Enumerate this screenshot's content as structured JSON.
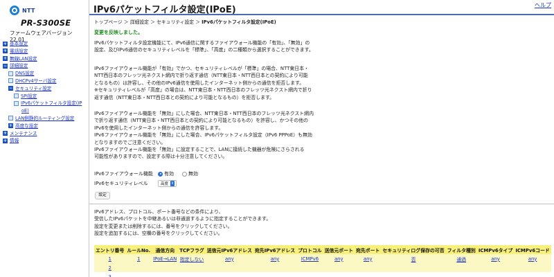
{
  "sidebar": {
    "logo_ntt": "NTT",
    "logo_model": "PR-S300SE",
    "firmware": "ファームウェアバージョン 22.01",
    "items": [
      {
        "label": "基本設定",
        "icon": "plus-box-icon",
        "level": 1
      },
      {
        "label": "電話設定",
        "icon": "plus-box-icon",
        "level": 1
      },
      {
        "label": "無線LAN設定",
        "icon": "plus-box-icon",
        "level": 1
      },
      {
        "label": "詳細設定",
        "icon": "minus-box-icon",
        "level": 1
      },
      {
        "label": "DNS設定",
        "icon": "leaf-icon",
        "level": 2
      },
      {
        "label": "DHCPv4サーバ設定",
        "icon": "leaf-icon",
        "level": 2
      },
      {
        "label": "セキュリティ設定",
        "icon": "minus-box-icon",
        "level": 2
      },
      {
        "label": "SPI設定",
        "icon": "leaf-icon",
        "level": 3
      },
      {
        "label": "IPv6パケットフィルタ設定(IP",
        "icon": "leaf-icon",
        "level": 3
      },
      {
        "label": "oE)",
        "icon": "",
        "level": 4
      },
      {
        "label": "LAN側静的ルーティング設定",
        "icon": "leaf-icon",
        "level": 2
      },
      {
        "label": "高度な設定",
        "icon": "plus-box-icon",
        "level": 2
      },
      {
        "label": "メンテナンス",
        "icon": "plus-box-icon",
        "level": 1
      },
      {
        "label": "情報",
        "icon": "plus-box-icon",
        "level": 1
      }
    ]
  },
  "header": {
    "title": "IPv6パケットフィルタ設定(IPoE)",
    "help": "ヘルプ"
  },
  "breadcrumb": {
    "path": "トップページ ＞ 詳細設定 ＞ セキュリティ設定 ＞ ",
    "current": "IPv6パケットフィルタ設定(IPoE)"
  },
  "status": "変更を反映しました。",
  "description": {
    "p1": [
      "IPv6パケットフィルタ設定機能にて、IPv6通信に関するファイアウォール機能の「有効」、「無効」の",
      "設定、及びIPv6通信のセキュリティレベルを「標準」、「高度」の二種類から選択することができます。"
    ],
    "p2": [
      "IPv6ファイアウォール機能が「有効」でかつ、セキュリティレベルが「標準」の場合、NTT東日本・",
      "NTT西日本のフレッツ光ネクスト網内で折り返す通信（NTT東日本・NTT西日本との契約により可能",
      "となるもの）は許容し、その他のIPv6通信を使用したインターネット側からの通信を拒否します。",
      "※セキュリティレベルが「高度」の場合は、NTT東日本・NTT西日本のフレッツ光ネクスト網内で折り",
      "返す通信（NTT東日本・NTT西日本との契約により可能となるもの）を拒否します。"
    ],
    "p3": [
      "IPv6ファイアウォール機能を「無効」にした場合、NTT東日本・NTT西日本のフレッツ光ネクスト網内",
      "で折り返す通信（NTT東日本・NTT西日本との契約により可能となるもの）を許容し、かつその他の",
      "IPv6を使用したインターネット側からの通信を許容します。",
      "IPv6ファイアウォール機能を「無効」にした場合、IPv6パケットフィルタ設定（IPv6 PPPoE）も無効",
      "となりますのでご注意ください。",
      "IPv6ファイアウォール機能を「無効」に設定することで、LANに接続した機器が危険にさらされる",
      "可能性がありますので、設定する際は十分注意してください。"
    ],
    "p4": [
      "IPv6アドレス、プロトコル、ポート番号などの条件により、",
      "受信したIPv6パケットを中継あるいは非通過するように指定することができます。",
      "設定を変更または削除するには、番号をクリックしてください。",
      "設定を追加するには、空欄の番号をクリックしてください。"
    ]
  },
  "form": {
    "firewall_label": "IPv6ファイアウォール機能",
    "firewall_on": "有効",
    "firewall_off": "無効",
    "firewall_selected": "有効",
    "security_label": "IPv6セキュリティレベル",
    "security_value": "高度",
    "set_button": "設定"
  },
  "table": {
    "headers": [
      "エントリ番号",
      "ルールNo.",
      "通信方向",
      "TCPフラグ",
      "送信元IPv6アドレス",
      "宛先IPv6アドレス",
      "プロトコル",
      "送信元ポート",
      "宛先ポート",
      "セキュリティログ保存の可否",
      "フィルタ種別",
      "ICMPv6タイプ",
      "ICMPv6コード"
    ],
    "rows": [
      [
        "1",
        "1",
        "IPoE→LAN",
        "指定しない",
        "any",
        "any",
        "ICMPv6",
        "any",
        "any",
        "否",
        "通過",
        "any",
        "any"
      ],
      [
        "2",
        "",
        "",
        "",
        "",
        "",
        "",
        "",
        "",
        "",
        "",
        "",
        ""
      ],
      [
        "3",
        "",
        "",
        "",
        "",
        "",
        "",
        "",
        "",
        "",
        "",
        "",
        ""
      ]
    ]
  },
  "colors": {
    "link": "#1a32c8",
    "status_green": "#1c8a1c",
    "table_header": "#f7f07a",
    "table_row": "#fcf8c4",
    "title_rule": "#4a6bb5"
  }
}
